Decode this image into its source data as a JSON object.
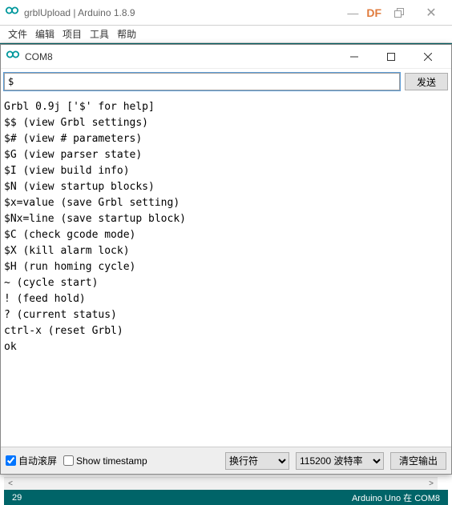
{
  "main_window": {
    "title": "grblUpload | Arduino 1.8.9",
    "df_label": "DF",
    "menu": {
      "file": "文件",
      "edit": "编辑",
      "sketch": "项目",
      "tools": "工具",
      "help": "帮助"
    },
    "status_left": "29",
    "status_right": "Arduino Uno 在 COM8"
  },
  "serial_monitor": {
    "title": "COM8",
    "input_value": "$",
    "send_label": "发送",
    "output_lines": [
      "Grbl 0.9j ['$' for help]",
      "$$ (view Grbl settings)",
      "$# (view # parameters)",
      "$G (view parser state)",
      "$I (view build info)",
      "$N (view startup blocks)",
      "$x=value (save Grbl setting)",
      "$Nx=line (save startup block)",
      "$C (check gcode mode)",
      "$X (kill alarm lock)",
      "$H (run homing cycle)",
      "~ (cycle start)",
      "! (feed hold)",
      "? (current status)",
      "ctrl-x (reset Grbl)",
      "ok"
    ],
    "autoscroll_label": "自动滚屏",
    "autoscroll_checked": true,
    "timestamp_label": "Show timestamp",
    "timestamp_checked": false,
    "line_ending": "换行符",
    "baud": "115200 波特率",
    "clear_label": "清空输出"
  }
}
